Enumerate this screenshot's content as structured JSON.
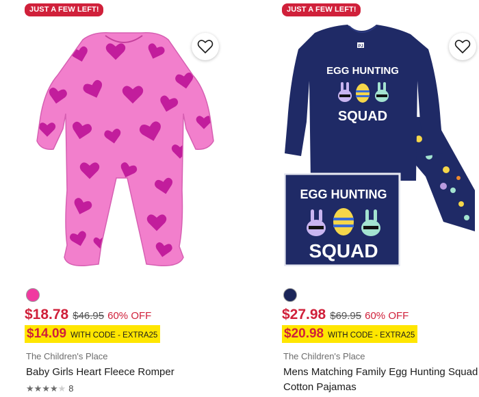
{
  "products": [
    {
      "badge": "JUST A FEW LEFT!",
      "image_icon": "pink-heart-romper",
      "swatch_color": "#f03aa0",
      "price_sale": "$18.78",
      "price_original": "$46.95",
      "discount": "60% OFF",
      "code_price": "$14.09",
      "code_label": "WITH CODE - EXTRA25",
      "brand": "The Children's Place",
      "title": "Baby Girls Heart Fleece Romper",
      "rating": {
        "stars": 4,
        "max": 5,
        "count": "8"
      }
    },
    {
      "badge": "JUST A FEW LEFT!",
      "image_icon": "egg-hunting-squad-pajamas",
      "swatch_color": "#1b2559",
      "price_sale": "$27.98",
      "price_original": "$69.95",
      "discount": "60% OFF",
      "code_price": "$20.98",
      "code_label": "WITH CODE - EXTRA25",
      "brand": "The Children's Place",
      "title": "Mens Matching Family Egg Hunting Squad Cotton Pajamas",
      "graphic_text": {
        "line1": "EGG HUNTING",
        "line2": "SQUAD",
        "tag": "PJ"
      }
    }
  ],
  "colors": {
    "sale_red": "#d0203a",
    "code_yellow": "#ffe600",
    "navy": "#1b2559",
    "pink": "#f07ccc",
    "magenta": "#c21d9c"
  }
}
